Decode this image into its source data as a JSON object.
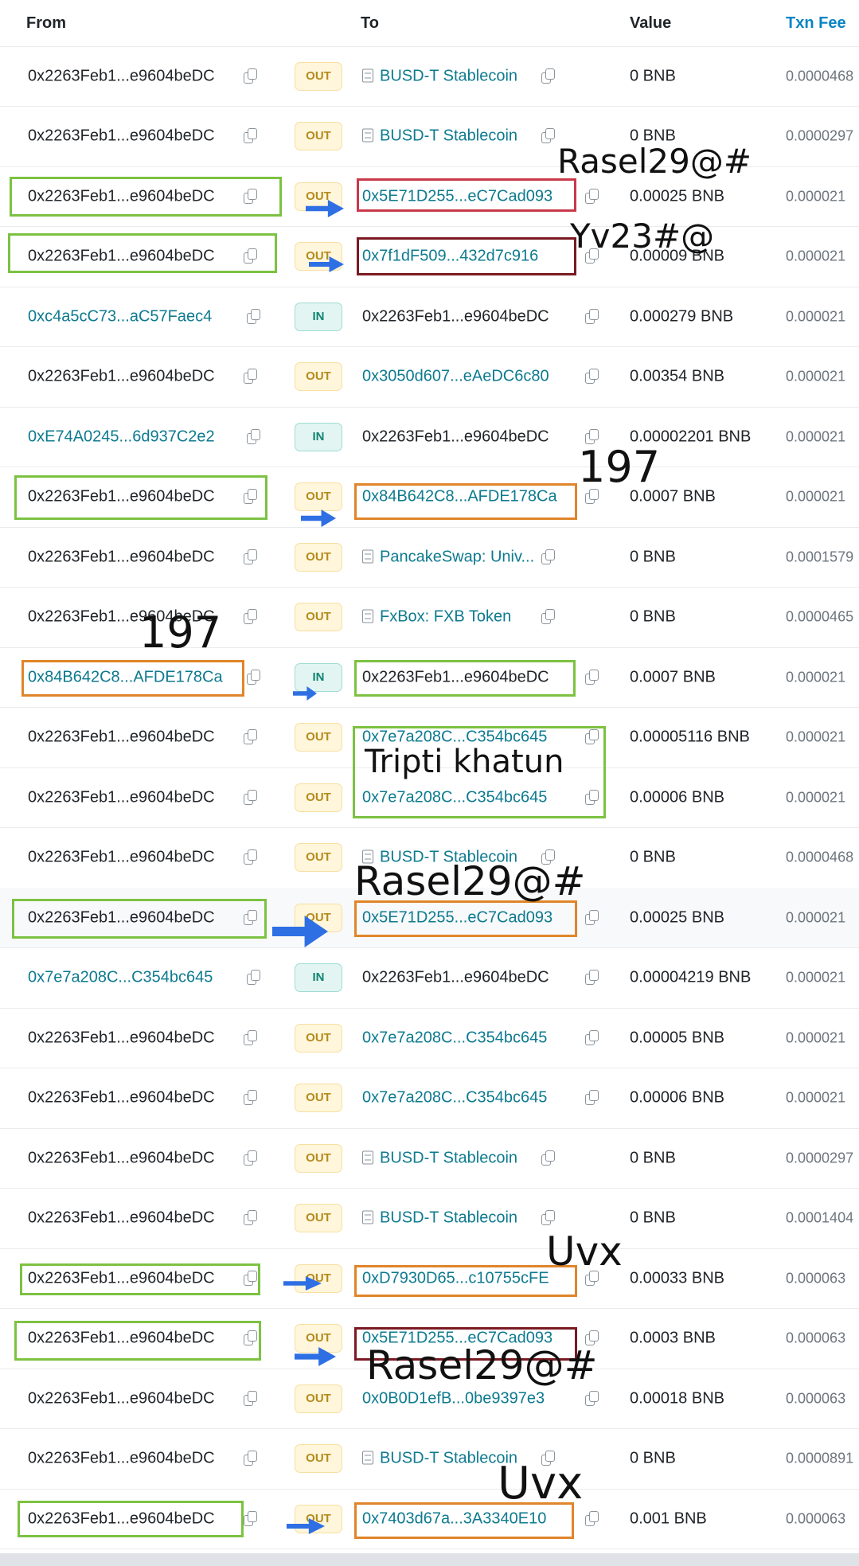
{
  "header": {
    "from": "From",
    "to": "To",
    "value": "Value",
    "fee": "Txn Fee"
  },
  "rows": [
    {
      "from": "0x2263Feb1...e9604beDC",
      "from_link": false,
      "dir": "OUT",
      "to": "BUSD-T Stablecoin",
      "to_link": true,
      "to_contract": true,
      "value": "0 BNB",
      "fee": "0.0000468"
    },
    {
      "from": "0x2263Feb1...e9604beDC",
      "from_link": false,
      "dir": "OUT",
      "to": "BUSD-T Stablecoin",
      "to_link": true,
      "to_contract": true,
      "value": "0 BNB",
      "fee": "0.0000297"
    },
    {
      "from": "0x2263Feb1...e9604beDC",
      "from_link": false,
      "dir": "OUT",
      "to": "0x5E71D255...eC7Cad093",
      "to_link": true,
      "to_contract": false,
      "value": "0.00025 BNB",
      "fee": "0.000021"
    },
    {
      "from": "0x2263Feb1...e9604beDC",
      "from_link": false,
      "dir": "OUT",
      "to": "0x7f1dF509...432d7c916",
      "to_link": true,
      "to_contract": false,
      "value": "0.00009 BNB",
      "fee": "0.000021"
    },
    {
      "from": "0xc4a5cC73...aC57Faec4",
      "from_link": true,
      "dir": "IN",
      "to": "0x2263Feb1...e9604beDC",
      "to_link": false,
      "to_contract": false,
      "value": "0.000279 BNB",
      "fee": "0.000021"
    },
    {
      "from": "0x2263Feb1...e9604beDC",
      "from_link": false,
      "dir": "OUT",
      "to": "0x3050d607...eAeDC6c80",
      "to_link": true,
      "to_contract": false,
      "value": "0.00354 BNB",
      "fee": "0.000021"
    },
    {
      "from": "0xE74A0245...6d937C2e2",
      "from_link": true,
      "dir": "IN",
      "to": "0x2263Feb1...e9604beDC",
      "to_link": false,
      "to_contract": false,
      "value": "0.00002201 BNB",
      "fee": "0.000021"
    },
    {
      "from": "0x2263Feb1...e9604beDC",
      "from_link": false,
      "dir": "OUT",
      "to": "0x84B642C8...AFDE178Ca",
      "to_link": true,
      "to_contract": false,
      "value": "0.0007 BNB",
      "fee": "0.000021"
    },
    {
      "from": "0x2263Feb1...e9604beDC",
      "from_link": false,
      "dir": "OUT",
      "to": "PancakeSwap: Univ...",
      "to_link": true,
      "to_contract": true,
      "value": "0 BNB",
      "fee": "0.0001579"
    },
    {
      "from": "0x2263Feb1...e9604beDC",
      "from_link": false,
      "dir": "OUT",
      "to": "FxBox: FXB Token",
      "to_link": true,
      "to_contract": true,
      "value": "0 BNB",
      "fee": "0.0000465"
    },
    {
      "from": "0x84B642C8...AFDE178Ca",
      "from_link": true,
      "dir": "IN",
      "to": "0x2263Feb1...e9604beDC",
      "to_link": false,
      "to_contract": false,
      "value": "0.0007 BNB",
      "fee": "0.000021"
    },
    {
      "from": "0x2263Feb1...e9604beDC",
      "from_link": false,
      "dir": "OUT",
      "to": "0x7e7a208C...C354bc645",
      "to_link": true,
      "to_contract": false,
      "value": "0.00005116 BNB",
      "fee": "0.000021"
    },
    {
      "from": "0x2263Feb1...e9604beDC",
      "from_link": false,
      "dir": "OUT",
      "to": "0x7e7a208C...C354bc645",
      "to_link": true,
      "to_contract": false,
      "value": "0.00006 BNB",
      "fee": "0.000021"
    },
    {
      "from": "0x2263Feb1...e9604beDC",
      "from_link": false,
      "dir": "OUT",
      "to": "BUSD-T Stablecoin",
      "to_link": true,
      "to_contract": true,
      "value": "0 BNB",
      "fee": "0.0000468"
    },
    {
      "from": "0x2263Feb1...e9604beDC",
      "from_link": false,
      "dir": "OUT",
      "to": "0x5E71D255...eC7Cad093",
      "to_link": true,
      "to_contract": false,
      "value": "0.00025 BNB",
      "fee": "0.000021"
    },
    {
      "from": "0x7e7a208C...C354bc645",
      "from_link": true,
      "dir": "IN",
      "to": "0x2263Feb1...e9604beDC",
      "to_link": false,
      "to_contract": false,
      "value": "0.00004219 BNB",
      "fee": "0.000021"
    },
    {
      "from": "0x2263Feb1...e9604beDC",
      "from_link": false,
      "dir": "OUT",
      "to": "0x7e7a208C...C354bc645",
      "to_link": true,
      "to_contract": false,
      "value": "0.00005 BNB",
      "fee": "0.000021"
    },
    {
      "from": "0x2263Feb1...e9604beDC",
      "from_link": false,
      "dir": "OUT",
      "to": "0x7e7a208C...C354bc645",
      "to_link": true,
      "to_contract": false,
      "value": "0.00006 BNB",
      "fee": "0.000021"
    },
    {
      "from": "0x2263Feb1...e9604beDC",
      "from_link": false,
      "dir": "OUT",
      "to": "BUSD-T Stablecoin",
      "to_link": true,
      "to_contract": true,
      "value": "0 BNB",
      "fee": "0.0000297"
    },
    {
      "from": "0x2263Feb1...e9604beDC",
      "from_link": false,
      "dir": "OUT",
      "to": "BUSD-T Stablecoin",
      "to_link": true,
      "to_contract": true,
      "value": "0 BNB",
      "fee": "0.0001404"
    },
    {
      "from": "0x2263Feb1...e9604beDC",
      "from_link": false,
      "dir": "OUT",
      "to": "0xD7930D65...c10755cFE",
      "to_link": true,
      "to_contract": false,
      "value": "0.00033 BNB",
      "fee": "0.000063"
    },
    {
      "from": "0x2263Feb1...e9604beDC",
      "from_link": false,
      "dir": "OUT",
      "to": "0x5E71D255...eC7Cad093",
      "to_link": true,
      "to_contract": false,
      "value": "0.0003 BNB",
      "fee": "0.000063"
    },
    {
      "from": "0x2263Feb1...e9604beDC",
      "from_link": false,
      "dir": "OUT",
      "to": "0x0B0D1efB...0be9397e3",
      "to_link": true,
      "to_contract": false,
      "value": "0.00018 BNB",
      "fee": "0.000063"
    },
    {
      "from": "0x2263Feb1...e9604beDC",
      "from_link": false,
      "dir": "OUT",
      "to": "BUSD-T Stablecoin",
      "to_link": true,
      "to_contract": true,
      "value": "0 BNB",
      "fee": "0.0000891"
    },
    {
      "from": "0x2263Feb1...e9604beDC",
      "from_link": false,
      "dir": "OUT",
      "to": "0x7403d67a...3A3340E10",
      "to_link": true,
      "to_contract": false,
      "value": "0.001 BNB",
      "fee": "0.000063"
    }
  ],
  "annotations": [
    {
      "id": "a1",
      "text": "Rasel29@#"
    },
    {
      "id": "a2",
      "text": "Yv23#@"
    },
    {
      "id": "a3",
      "text": "197"
    },
    {
      "id": "a4",
      "text": "197"
    },
    {
      "id": "a5",
      "text": "Tripti khatun"
    },
    {
      "id": "a6",
      "text": "Rasel29@#"
    },
    {
      "id": "a7",
      "text": "Uvx"
    },
    {
      "id": "a8",
      "text": "Rasel29@#"
    },
    {
      "id": "a9",
      "text": "Uvx"
    }
  ],
  "colors": {
    "link": "#0d7a8f",
    "out_badge": "#b48a1c",
    "in_badge": "#118472",
    "box_green": "#7cc242",
    "box_orange": "#e0852a",
    "box_red": "#c8394a",
    "box_maroon": "#7a1a22",
    "arrow_blue": "#2f6fe4"
  }
}
